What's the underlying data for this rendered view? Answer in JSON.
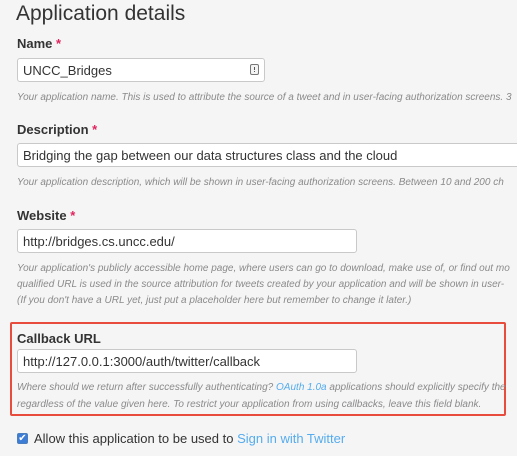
{
  "page": {
    "title": "Application details"
  },
  "name": {
    "label": "Name",
    "required_mark": "*",
    "value": "UNCC_Bridges",
    "hint": "Your application name. This is used to attribute the source of a tweet and in user-facing authorization screens. 3"
  },
  "description": {
    "label": "Description",
    "required_mark": "*",
    "value": "Bridging the gap between our data structures class and the cloud",
    "hint": "Your application description, which will be shown in user-facing authorization screens. Between 10 and 200 ch"
  },
  "website": {
    "label": "Website",
    "required_mark": "*",
    "value": "http://bridges.cs.uncc.edu/",
    "hint_line1": "Your application's publicly accessible home page, where users can go to download, make use of, or find out mo",
    "hint_line2": "qualified URL is used in the source attribution for tweets created by your application and will be shown in user-",
    "hint_line3": "(If you don't have a URL yet, just put a placeholder here but remember to change it later.)"
  },
  "callback": {
    "label": "Callback URL",
    "value": "http://127.0.0.1:3000/auth/twitter/callback",
    "hint_line1_before": "Where should we return after successfully authenticating? ",
    "hint_link": "OAuth 1.0a",
    "hint_line1_after": " applications should explicitly specify the",
    "hint_line2": "regardless of the value given here. To restrict your application from using callbacks, leave this field blank."
  },
  "signin": {
    "checked": true,
    "check_glyph": "✔",
    "label_before": "Allow this application to be used to ",
    "label_link": "Sign in with Twitter"
  },
  "colors": {
    "highlight_border": "#e74c3c",
    "link": "#55acee",
    "required": "#e0245e"
  },
  "icons": {
    "name_field_icon": "info-icon"
  }
}
